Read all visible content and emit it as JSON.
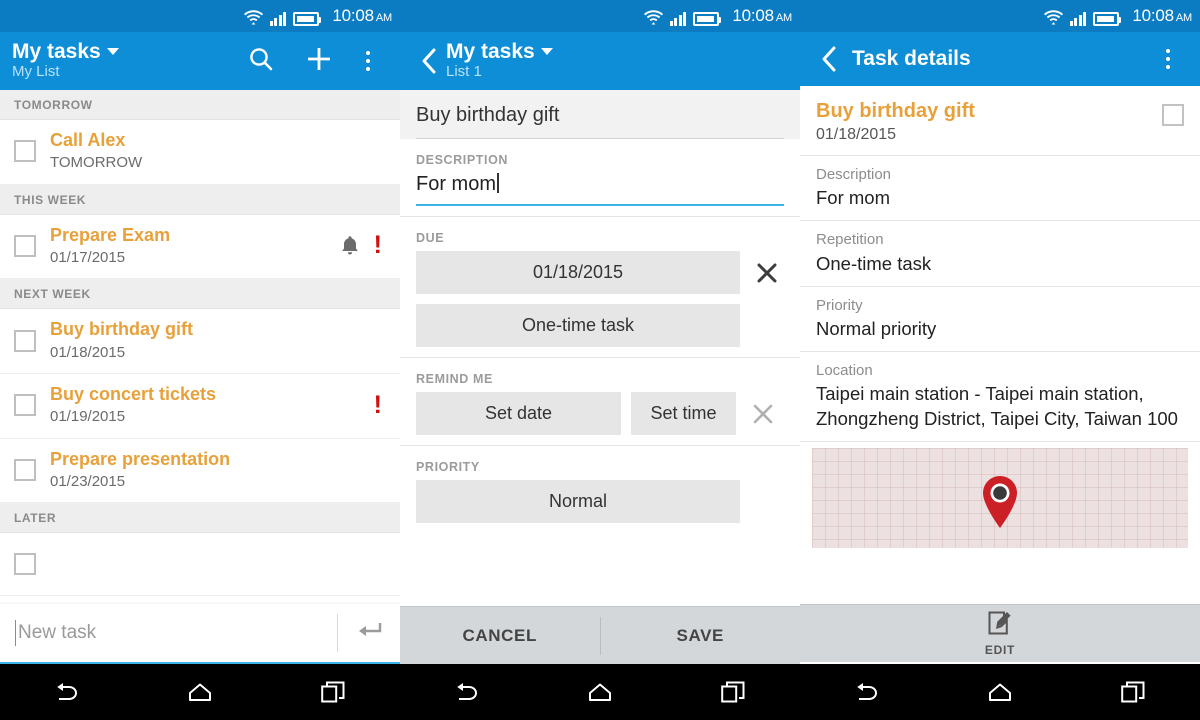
{
  "statusbar": {
    "time": "10:08",
    "ampm": "AM",
    "wifi_icon": "wifi-icon",
    "signal_icon": "signal-icon",
    "battery_icon": "battery-icon"
  },
  "colors": {
    "action_bar": "#0e8ed6",
    "status_bar": "#0b7cc1",
    "accent_orange": "#e8a13a",
    "alert_red": "#cc1111",
    "field_gray": "#e6e6e6",
    "bottom_bar": "#d4d7da"
  },
  "screen1": {
    "title": "My tasks",
    "subtitle": "My List",
    "actions": {
      "search": "search-icon",
      "add": "plus-icon",
      "overflow": "overflow-menu-icon"
    },
    "sections": [
      {
        "header": "TOMORROW",
        "tasks": [
          {
            "title": "Call Alex",
            "sub": "TOMORROW",
            "reminder": false,
            "priority": false
          }
        ]
      },
      {
        "header": "THIS WEEK",
        "tasks": [
          {
            "title": "Prepare Exam",
            "sub": "01/17/2015",
            "reminder": true,
            "priority": true
          }
        ]
      },
      {
        "header": "NEXT WEEK",
        "tasks": [
          {
            "title": "Buy birthday gift",
            "sub": "01/18/2015",
            "reminder": false,
            "priority": false
          },
          {
            "title": "Buy concert tickets",
            "sub": "01/19/2015",
            "reminder": false,
            "priority": true
          },
          {
            "title": "Prepare presentation",
            "sub": "01/23/2015",
            "reminder": false,
            "priority": false
          }
        ]
      },
      {
        "header": "LATER",
        "tasks": []
      }
    ],
    "new_task_placeholder": "New task",
    "enter_icon": "enter-key-icon"
  },
  "screen2": {
    "title": "My tasks",
    "subtitle": "List 1",
    "back_icon": "back-arrow-icon",
    "task_title_value": "Buy birthday gift",
    "description_label": "DESCRIPTION",
    "description_value": "For mom",
    "due_label": "DUE",
    "due_date": "01/18/2015",
    "due_repeat": "One-time task",
    "due_clear_icon": "clear-icon",
    "remind_label": "REMIND ME",
    "remind_date": "Set date",
    "remind_time": "Set time",
    "remind_clear_icon": "clear-icon",
    "priority_label": "PRIORITY",
    "priority_value": "Normal",
    "cancel_label": "CANCEL",
    "save_label": "SAVE"
  },
  "screen3": {
    "title": "Task details",
    "back_icon": "back-arrow-icon",
    "overflow": "overflow-menu-icon",
    "task_title": "Buy birthday gift",
    "task_date": "01/18/2015",
    "rows": [
      {
        "label": "Description",
        "value": "For mom"
      },
      {
        "label": "Repetition",
        "value": "One-time task"
      },
      {
        "label": "Priority",
        "value": "Normal priority"
      },
      {
        "label": "Location",
        "value": "Taipei main station - Taipei main station, Zhongzheng District, Taipei City, Taiwan 100"
      }
    ],
    "map_pin_icon": "map-pin-icon",
    "edit_label": "EDIT",
    "edit_icon": "edit-pencil-icon"
  },
  "navbar": {
    "back": "nav-back-icon",
    "home": "nav-home-icon",
    "recents": "nav-recents-icon"
  }
}
